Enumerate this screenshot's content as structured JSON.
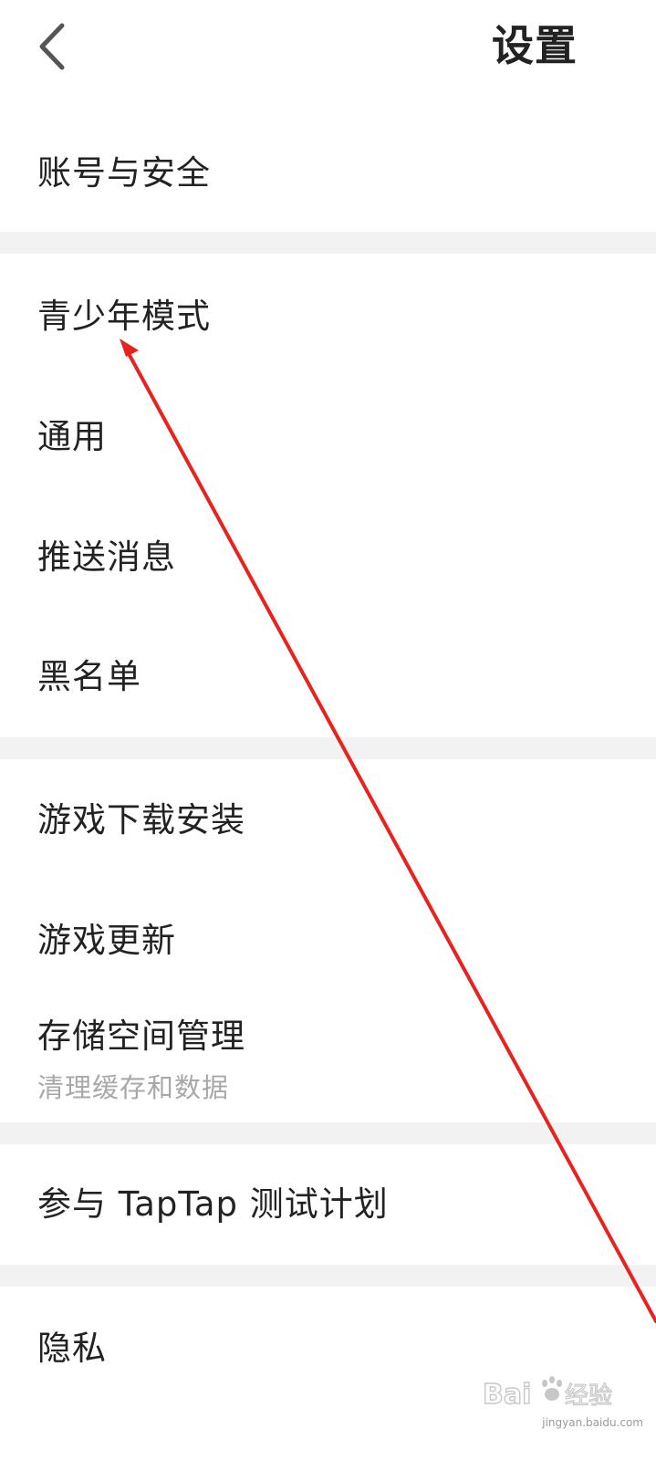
{
  "header": {
    "title": "设置",
    "back_icon": "chevron-left-icon"
  },
  "sections": [
    {
      "items": [
        {
          "label": "账号与安全"
        }
      ]
    },
    {
      "items": [
        {
          "label": "青少年模式"
        },
        {
          "label": "通用"
        },
        {
          "label": "推送消息"
        },
        {
          "label": "黑名单"
        }
      ]
    },
    {
      "items": [
        {
          "label": "游戏下载安装"
        },
        {
          "label": "游戏更新"
        },
        {
          "label": "存储空间管理",
          "sublabel": "清理缓存和数据"
        }
      ]
    },
    {
      "items": [
        {
          "label": "参与 TapTap 测试计划"
        }
      ]
    },
    {
      "items": [
        {
          "label": "隐私"
        }
      ]
    }
  ],
  "annotation": {
    "color": "#e8231f",
    "points_to": "青少年模式"
  },
  "watermark": {
    "text": "jingyan.baidu.com"
  },
  "colors": {
    "background": "#ffffff",
    "divider": "#f2f2f2",
    "text": "#222222",
    "subtext": "#a8a8a8"
  }
}
